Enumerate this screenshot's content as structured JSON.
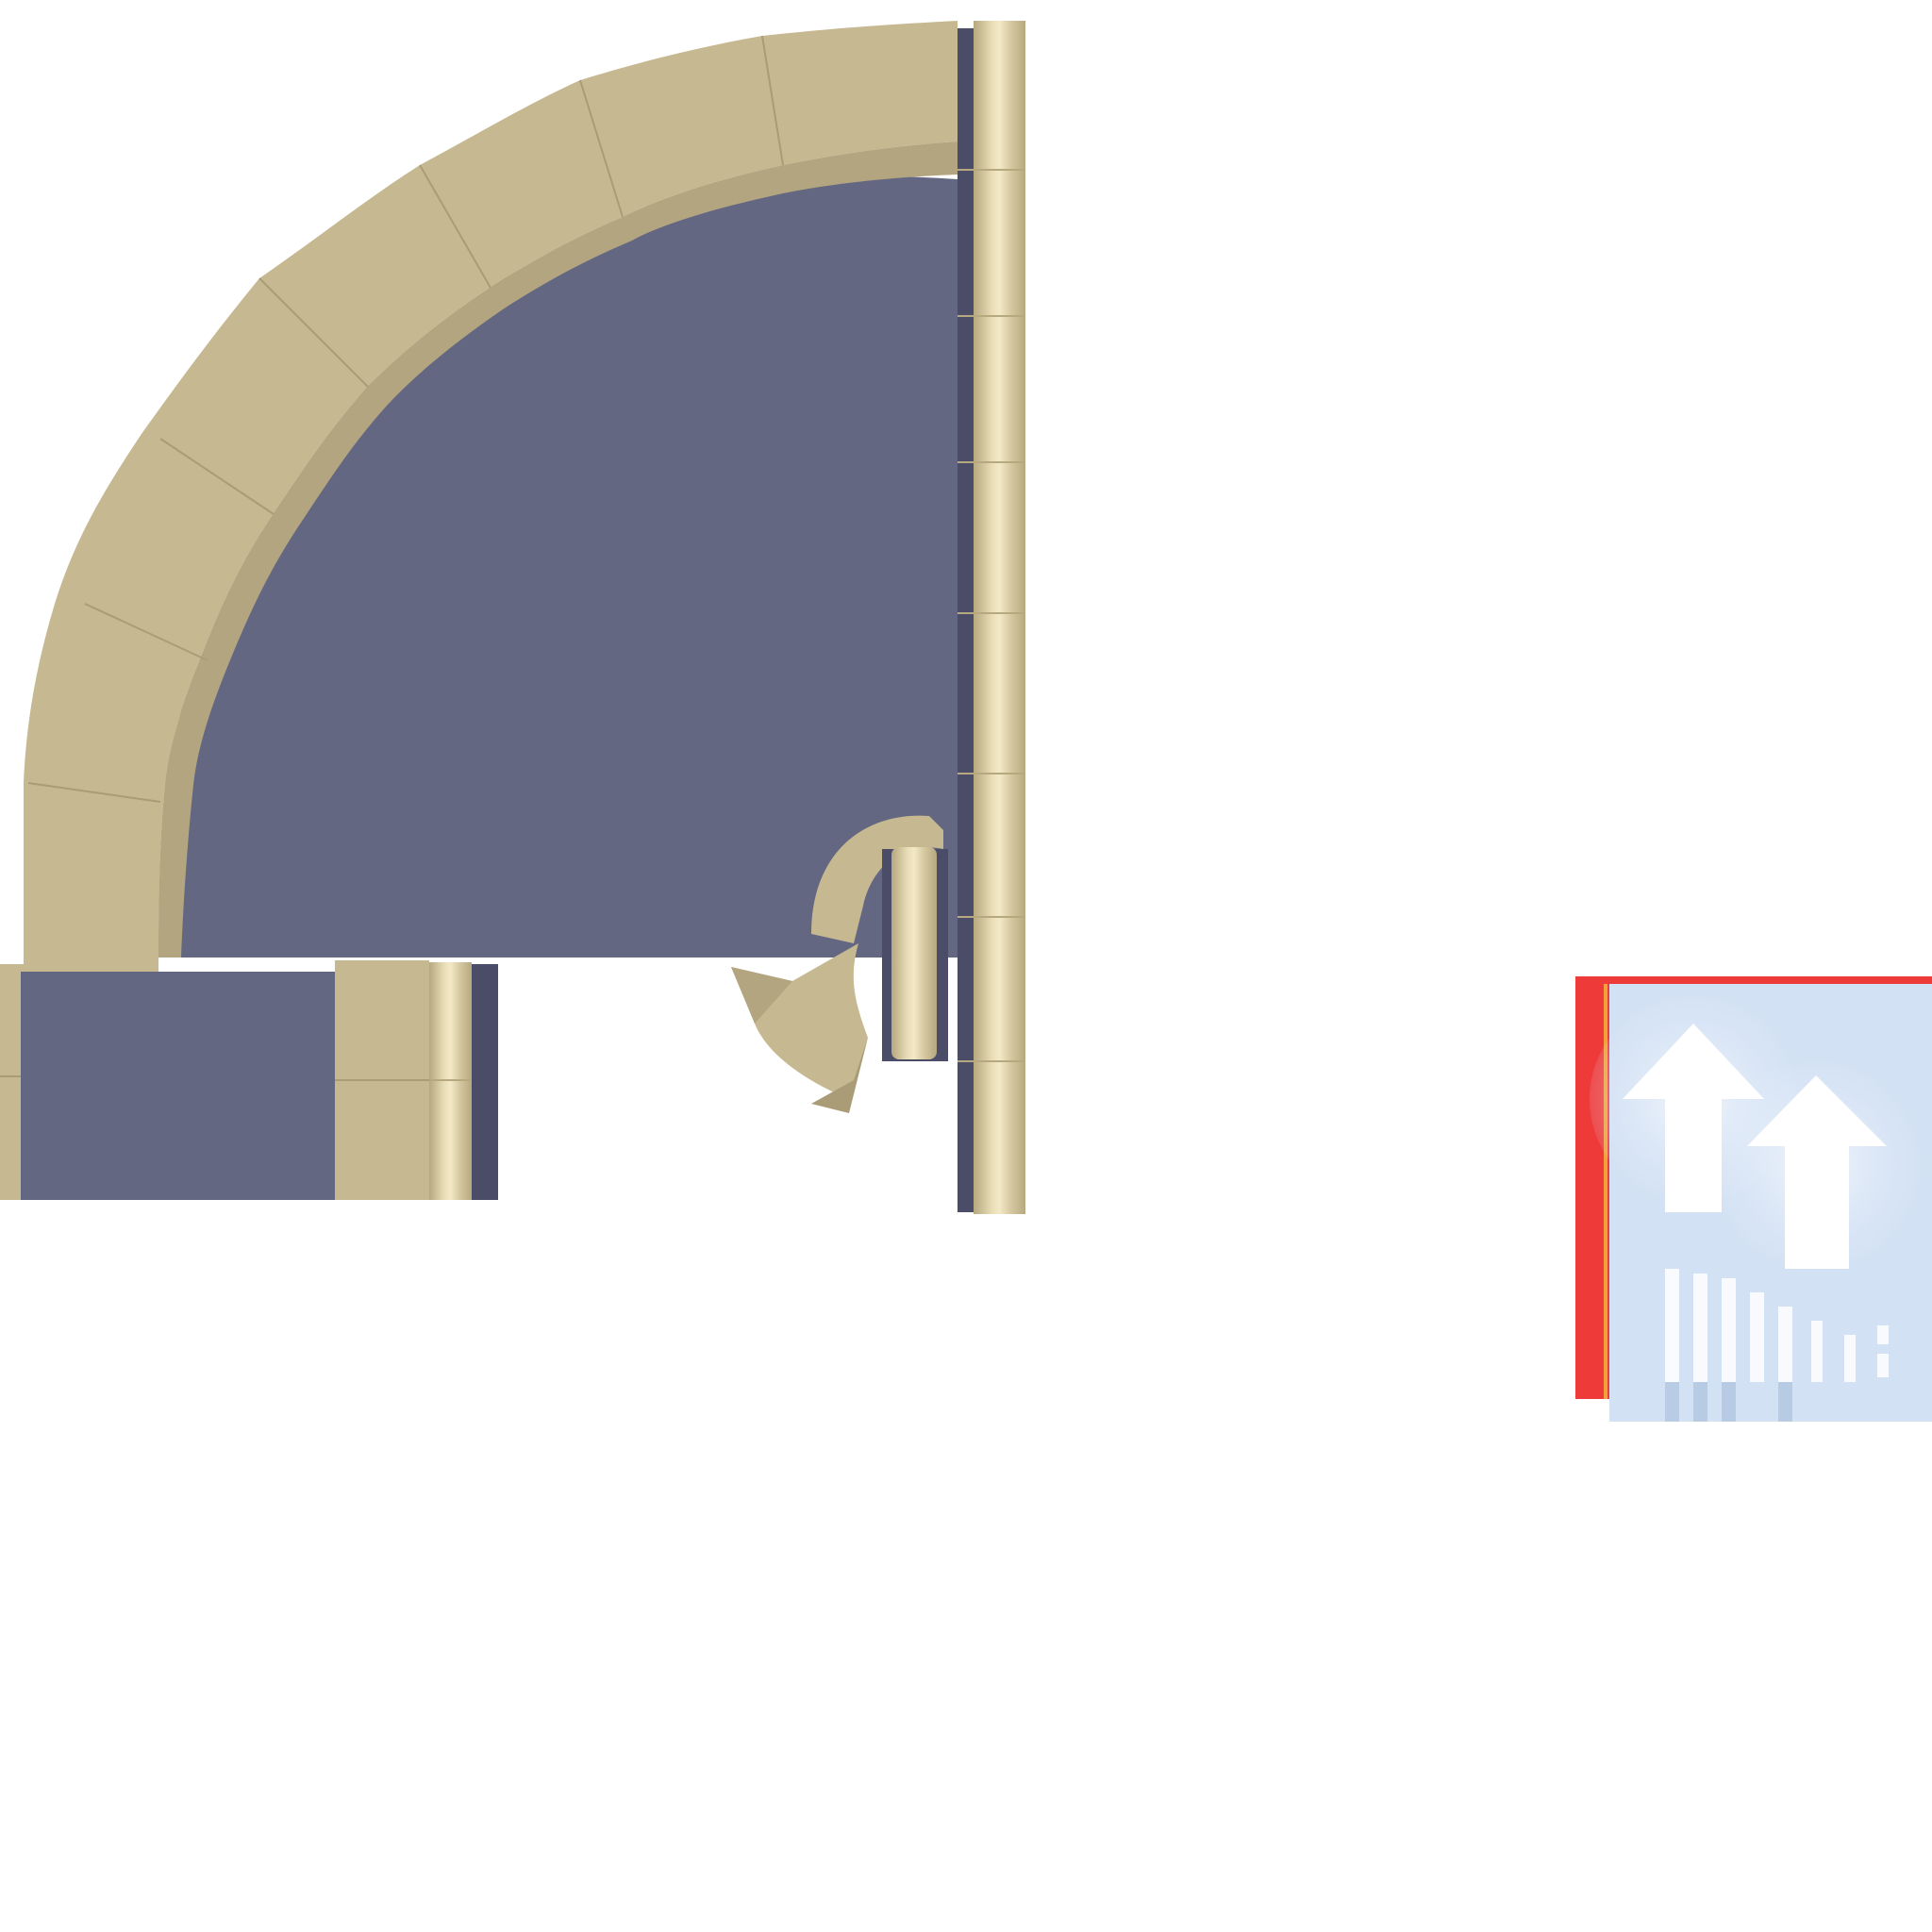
{
  "colors": {
    "background": "#ffffff",
    "stone": "#c6b891",
    "stone_light": "#d8cba4",
    "stone_dark": "#a99c76",
    "stone_edge": "#b3a57f",
    "floor": "#646782",
    "floor_dark": "#4b4d68",
    "pillar_highlight": "#f3e9c6",
    "pillar_shadow": "#b6a87f",
    "upgrade_frame": "#ef3a3a",
    "upgrade_frame_accent": "#f0a13a",
    "upgrade_panel": "#dae7f7",
    "upgrade_panel_dark": "#c7d8ee",
    "arrow": "#ffffff"
  },
  "icons": {
    "upgrade": "double-up-arrow-icon"
  }
}
